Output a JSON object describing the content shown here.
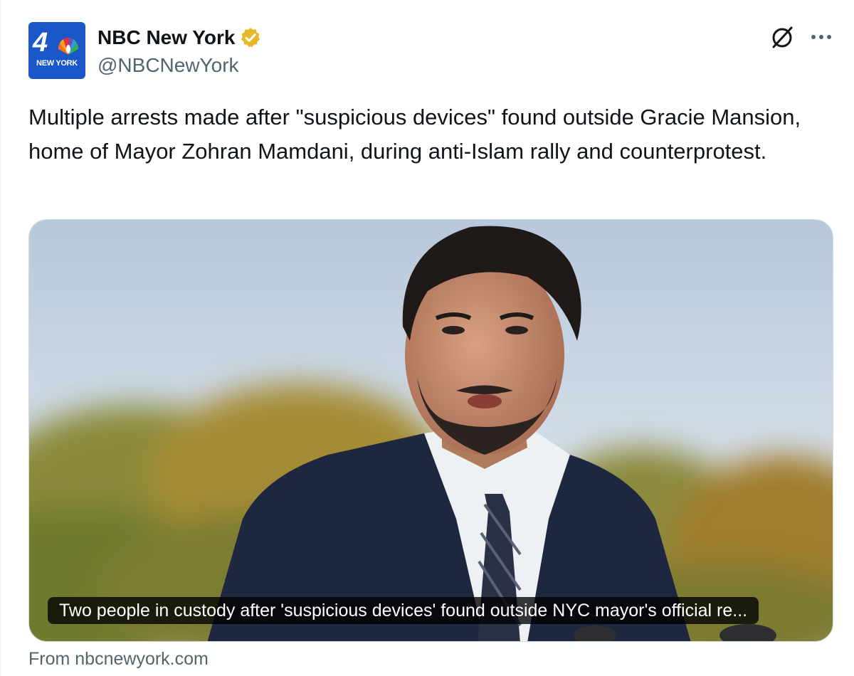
{
  "account": {
    "avatar_number": "4",
    "avatar_label": "NEW YORK",
    "display_name": "NBC New York",
    "handle": "@NBCNewYork",
    "verified_color": "#e8b829"
  },
  "actions": {
    "grok_icon": "grok-icon",
    "more_icon": "more-horizontal-icon"
  },
  "tweet": {
    "text": "Multiple arrests made after \"suspicious devices\" found outside Gracie Mansion, home of Mayor Zohran Mamdani, during anti-Islam rally and counterprotest."
  },
  "card": {
    "caption": "Two people in custody after 'suspicious devices' found outside NYC mayor's official re...",
    "source": "From nbcnewyork.com"
  },
  "colors": {
    "text_primary": "#0f1419",
    "text_secondary": "#536471",
    "avatar_bg": "#1a57c9"
  }
}
